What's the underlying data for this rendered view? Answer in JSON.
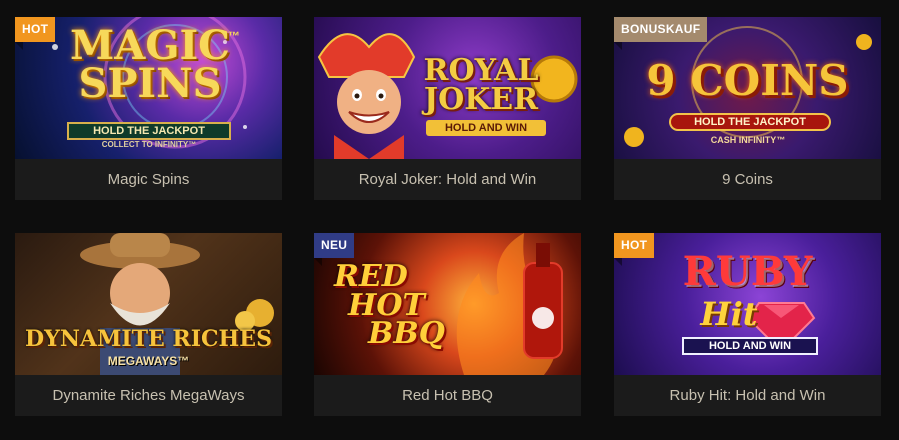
{
  "games": [
    {
      "title": "Magic Spins",
      "badge": "HOT",
      "logo_line1": "MAGIC",
      "logo_line2": "SPINS",
      "logo_tm": "™",
      "logo_sub1": "HOLD THE JACKPOT",
      "logo_sub2": "COLLECT TO INFINITY™"
    },
    {
      "title": "Royal Joker: Hold and Win",
      "badge": "",
      "logo_line1": "ROYAL",
      "logo_line2": "JOKER",
      "logo_sub1": "HOLD AND WIN"
    },
    {
      "title": "9 Coins",
      "badge": "BONUSKAUF",
      "logo_line1": "9 COINS",
      "logo_sub1": "HOLD THE JACKPOT",
      "logo_sub2": "CASH INFINITY™"
    },
    {
      "title": "Dynamite Riches MegaWays",
      "badge": "",
      "logo_line1": "DYNAMITE RICHES",
      "logo_sub1": "MEGAWAYS™"
    },
    {
      "title": "Red Hot BBQ",
      "badge": "NEU",
      "logo_line1": "RED",
      "logo_line2": "HOT",
      "logo_line3": "BBQ"
    },
    {
      "title": "Ruby Hit: Hold and Win",
      "badge": "HOT",
      "logo_line1": "RUBY",
      "logo_line2": "Hit",
      "logo_sub1": "HOLD AND WIN"
    }
  ],
  "colors": {
    "hot": "#f1961f",
    "bonus": "#a48a6d",
    "new": "#303c86",
    "card": "#1b1b1b",
    "caption_text": "#c7c0b0"
  }
}
